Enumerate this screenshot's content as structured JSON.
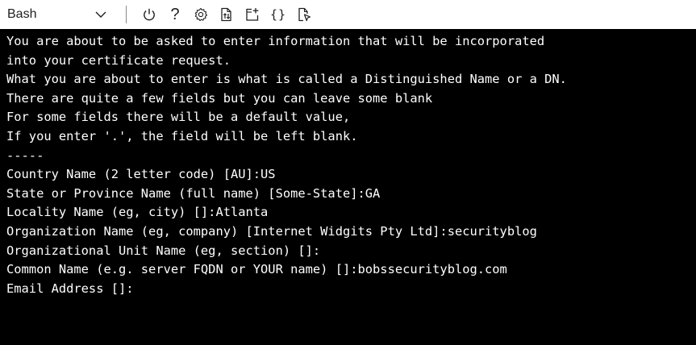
{
  "toolbar": {
    "shell_label": "Bash",
    "icons": [
      "chevron-down-icon",
      "power-icon",
      "help-icon",
      "settings-icon",
      "upload-download-icon",
      "new-session-icon",
      "editor-braces-icon",
      "web-preview-icon"
    ],
    "help_glyph": "?",
    "braces_glyph": "{}",
    "colors": {
      "background": "#ffffff",
      "icon": "#1f1f1f",
      "separator": "#8a8a8a"
    }
  },
  "terminal": {
    "colors": {
      "background": "#000000",
      "foreground": "#ffffff"
    },
    "lines": [
      "You are about to be asked to enter information that will be incorporated",
      "into your certificate request.",
      "What you are about to enter is what is called a Distinguished Name or a DN.",
      "There are quite a few fields but you can leave some blank",
      "For some fields there will be a default value,",
      "If you enter '.', the field will be left blank.",
      "-----",
      "Country Name (2 letter code) [AU]:US",
      "State or Province Name (full name) [Some-State]:GA",
      "Locality Name (eg, city) []:Atlanta",
      "Organization Name (eg, company) [Internet Widgits Pty Ltd]:securityblog",
      "Organizational Unit Name (eg, section) []:",
      "Common Name (e.g. server FQDN or YOUR name) []:bobssecurityblog.com",
      "Email Address []:"
    ]
  }
}
